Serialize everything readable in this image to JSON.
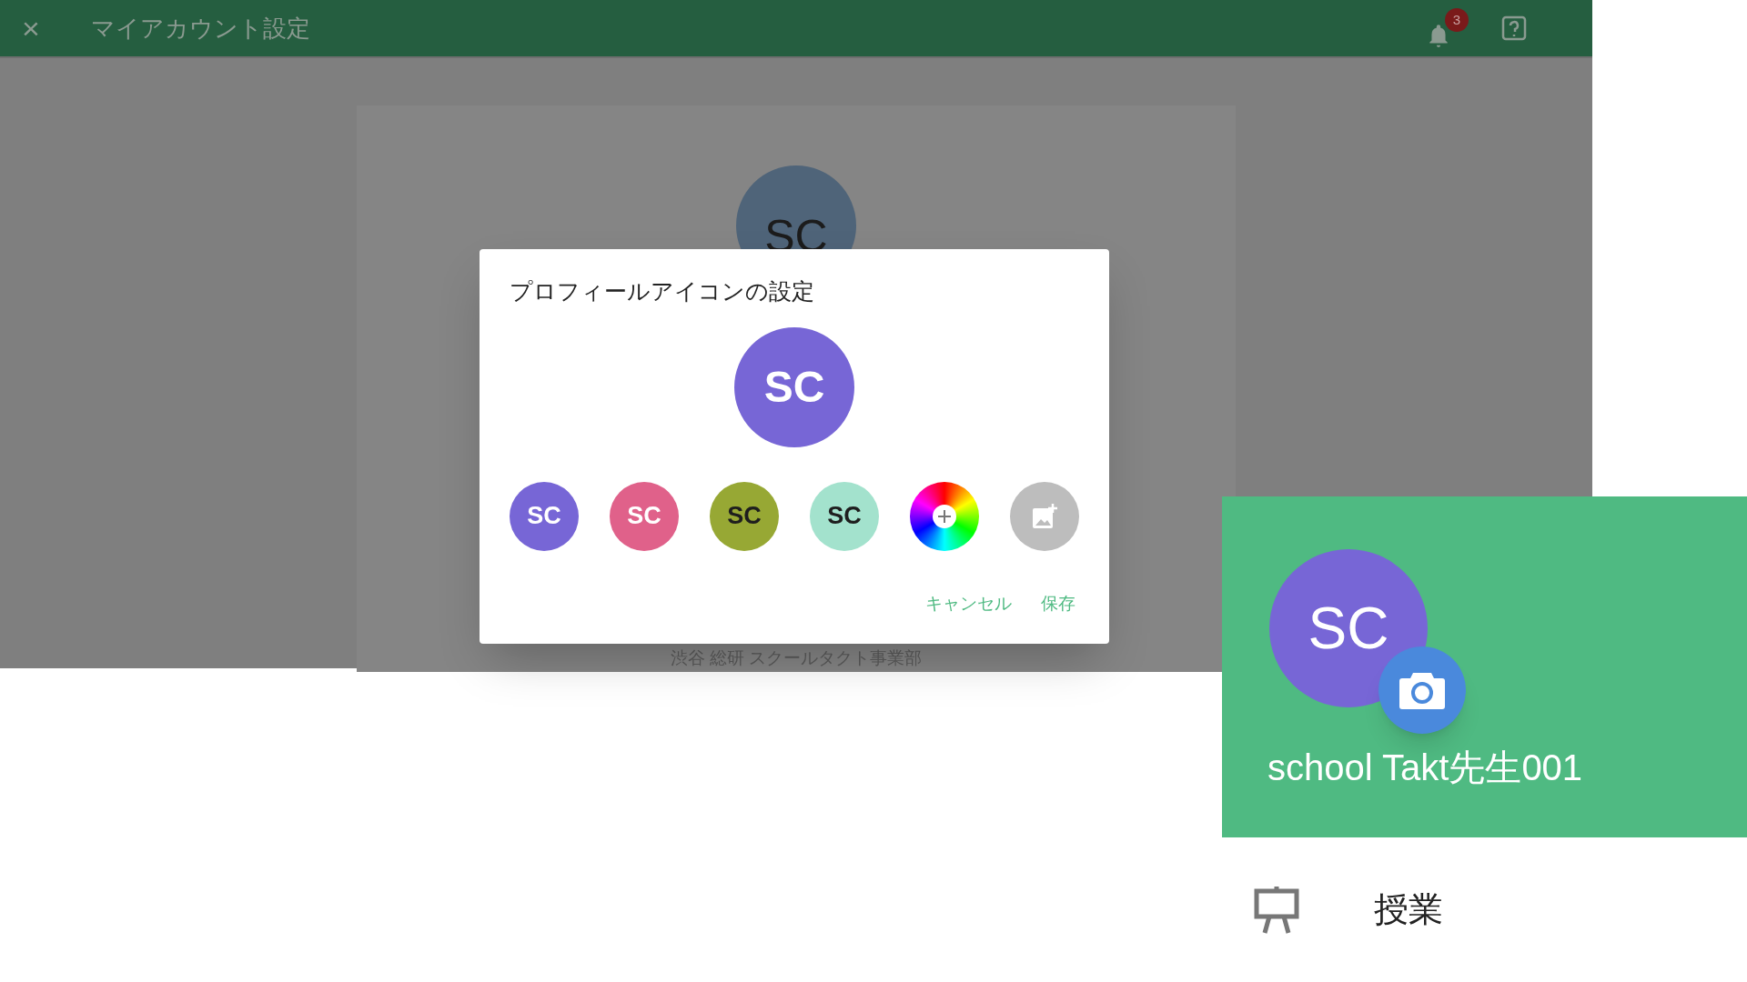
{
  "app_bar": {
    "close": "×",
    "title": "マイアカウント設定",
    "notification_count": "3"
  },
  "profile_card": {
    "avatar": "SC",
    "department": "渋谷 総研 スクールタクト事業部"
  },
  "dialog": {
    "title": "プロフィールアイコンの設定",
    "preview": {
      "initials": "SC",
      "color": "#7766d6"
    },
    "options": [
      {
        "kind": "initials",
        "initials": "SC",
        "color": "#7766d6",
        "dark_text": false
      },
      {
        "kind": "initials",
        "initials": "SC",
        "color": "#e0618a",
        "dark_text": false
      },
      {
        "kind": "initials",
        "initials": "SC",
        "color": "#97a834",
        "dark_text": true
      },
      {
        "kind": "initials",
        "initials": "SC",
        "color": "#a3e2cd",
        "dark_text": true
      },
      {
        "kind": "color-wheel"
      },
      {
        "kind": "image-upload"
      }
    ],
    "buttons": [
      "キャンセル",
      "保存"
    ]
  },
  "zoom_inset": {
    "avatar": "SC",
    "name": "school Takt先生001",
    "menu_items": [
      {
        "label": "授業"
      }
    ]
  }
}
